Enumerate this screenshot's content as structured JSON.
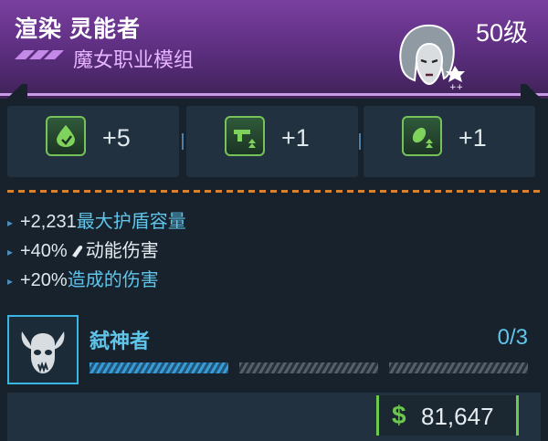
{
  "header": {
    "title": "渲染 灵能者",
    "subtitle": "魔女职业模组",
    "level": "50级",
    "accent_color": "#7a3fa0",
    "portrait_icon": "siren-portrait-icon"
  },
  "stats": [
    {
      "icon": "shield-drop-icon",
      "value": "+5"
    },
    {
      "icon": "gun-upgrade-icon",
      "value": "+1"
    },
    {
      "icon": "grenade-upgrade-icon",
      "value": "+1"
    }
  ],
  "bonuses": [
    {
      "value": "+2,231",
      "text": "最大护盾容量"
    },
    {
      "value": "+40%",
      "icon": "kinetic-bullet-icon",
      "text": "动能伤害"
    },
    {
      "value": "+20%",
      "text": "造成的伤害"
    }
  ],
  "perk": {
    "icon": "horned-skull-icon",
    "name": "弑神者",
    "progress": "0/3",
    "filled_segments": 1,
    "total_segments": 3
  },
  "price": {
    "currency_symbol": "$",
    "amount": "81,647"
  }
}
